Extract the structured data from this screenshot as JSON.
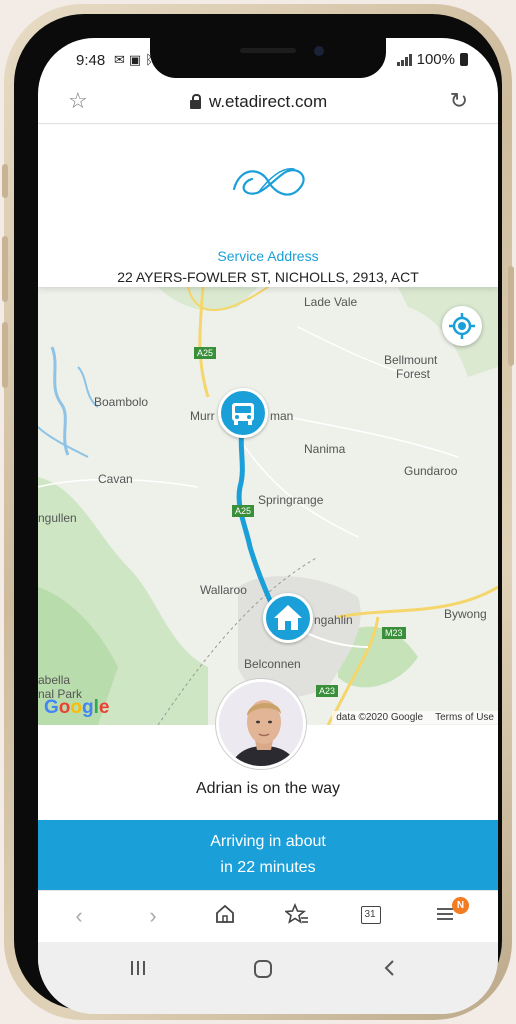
{
  "status_bar": {
    "time": "9:48",
    "notification_icons": [
      "mail-icon",
      "image-icon",
      "bluetooth-icon"
    ],
    "battery": "100%"
  },
  "browser": {
    "url": "w.etadirect.com",
    "bookmark_icon": "star-icon",
    "reload_icon": "reload-icon"
  },
  "header": {
    "service_label": "Service Address",
    "service_address": "22 AYERS-FOWLER ST, NICHOLLS, 2913, ACT"
  },
  "map": {
    "labels": {
      "lade_vale": "Lade Vale",
      "bellmount_1": "Bellmount",
      "bellmount_2": "Forest",
      "boambolo": "Boambolo",
      "murr": "Murr",
      "man": "man",
      "nanima": "Nanima",
      "gundaroo": "Gundaroo",
      "cavan": "Cavan",
      "ngullen": "ngullen",
      "springrange": "Springrange",
      "wallaroo": "Wallaroo",
      "bywong": "Bywong",
      "gungahlin": "ngahlin",
      "belconnen": "Belconnen",
      "abella": "abella",
      "nal_park": "nal Park",
      "road_a25_1": "A25",
      "road_a25_2": "A25",
      "road_m23": "M23",
      "road_a23": "A23"
    },
    "google": "Google",
    "attribution": "data ©2020 Google",
    "terms": "Terms of Use",
    "route_color": "#1a9fd9"
  },
  "driver": {
    "message": "Adrian is on the way"
  },
  "eta": {
    "line1": "Arriving in about",
    "line2": "in 22 minutes"
  },
  "browser_nav": {
    "back": "‹",
    "forward": "›",
    "tabs_count": "31",
    "menu_badge": "N"
  },
  "colors": {
    "accent": "#1a9fd9",
    "badge": "#f37b21"
  }
}
